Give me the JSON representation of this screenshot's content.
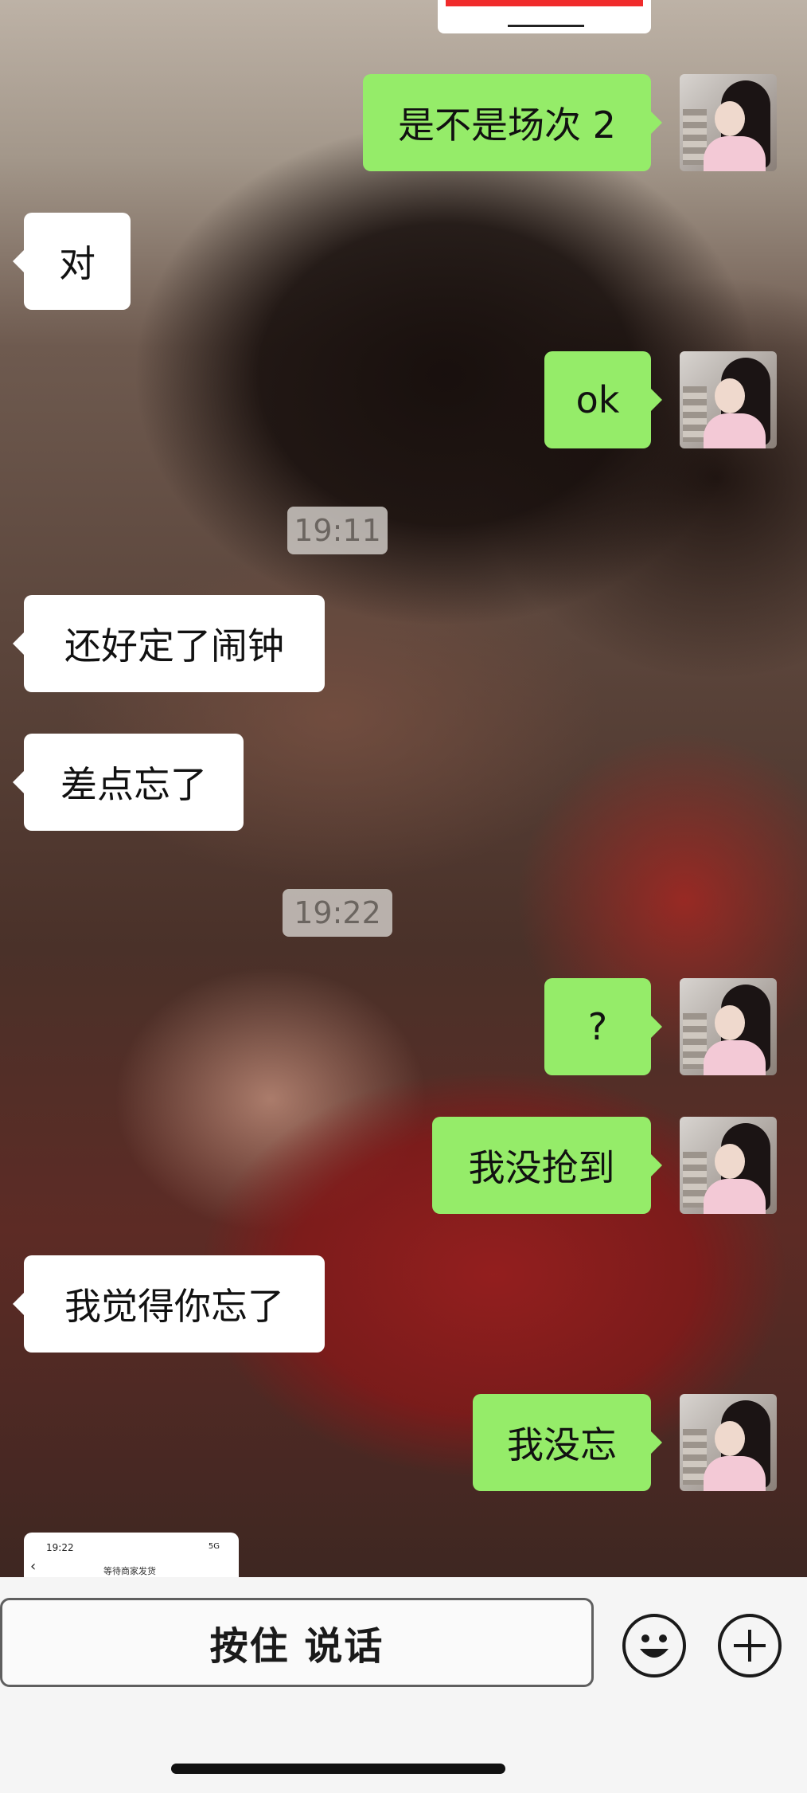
{
  "chat": {
    "messages": [
      {
        "side": "out",
        "text": "是不是场次 2"
      },
      {
        "side": "in",
        "text": "对"
      },
      {
        "side": "out",
        "text": "ok"
      },
      {
        "side": "time",
        "text": "19:11"
      },
      {
        "side": "in",
        "text": "还好定了闹钟"
      },
      {
        "side": "in",
        "text": "差点忘了"
      },
      {
        "side": "time",
        "text": "19:22"
      },
      {
        "side": "out",
        "text": "?"
      },
      {
        "side": "out",
        "text": "我没抢到"
      },
      {
        "side": "in",
        "text": "我觉得你忘了"
      },
      {
        "side": "out",
        "text": "我没忘"
      }
    ],
    "image_preview": {
      "time": "19:22",
      "status": "5G",
      "title": "等待商家发货"
    }
  },
  "input_bar": {
    "voice_label": "按住 说话",
    "emoji_icon": "smiley-icon",
    "plus_icon": "plus-circle-icon"
  },
  "colors": {
    "outgoing_bubble": "#95ec69",
    "incoming_bubble": "#ffffff",
    "timestamp_bg": "#cdc8c3"
  }
}
